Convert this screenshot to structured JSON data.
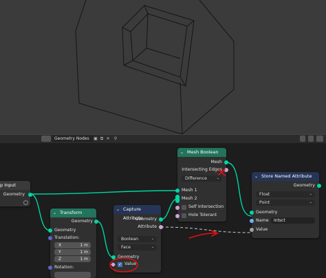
{
  "header": {
    "tree_name": "Geometry Nodes"
  },
  "nodes": {
    "group_input": {
      "title": "p Input",
      "geometry": "Geometry"
    },
    "transform": {
      "title": "Transform",
      "geometry_out": "Geometry",
      "geometry_in": "Geometry",
      "translation": "Translation:",
      "x_label": "X",
      "x_value": "1 m",
      "y_label": "Y",
      "y_value": "1 m",
      "z_label": "Z",
      "z_value": "1 m",
      "rotation": "Rotation:"
    },
    "capture_attribute": {
      "title": "Capture Attribute",
      "geometry_out": "Geometry",
      "attribute_out": "Attribute",
      "data_type": "Boolean",
      "domain": "Face",
      "geometry_in": "Geometry",
      "value": "Value",
      "value_checked": true
    },
    "mesh_boolean": {
      "title": "Mesh Boolean",
      "mesh_out": "Mesh",
      "intersecting_edges": "Intersecting Edges",
      "operation": "Difference",
      "mesh1": "Mesh 1",
      "mesh2": "Mesh 2",
      "self_intersection": "Self Intersection",
      "hole_tolerant": "Hole Tolerant"
    },
    "store_named_attribute": {
      "title": "Store Named Attribute",
      "geometry_out": "Geometry",
      "data_type": "Float",
      "domain": "Point",
      "geometry_in": "Geometry",
      "name_label": "Name",
      "name_value": "Intsct",
      "value": "Value"
    }
  },
  "colors": {
    "geometry_socket": "#00d6a3",
    "annotation": "#e01010",
    "node_header_green": "#22745c",
    "node_header_blue": "#263557"
  }
}
